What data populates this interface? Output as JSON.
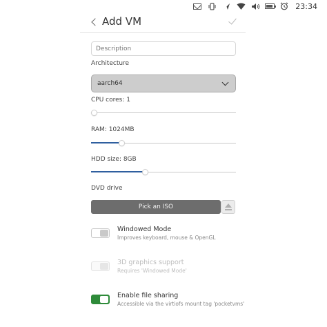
{
  "status_bar": {
    "time": "23:34",
    "icons": [
      "mail-icon",
      "vibrate-icon",
      "location-icon",
      "wifi-icon",
      "volume-icon",
      "battery-icon",
      "alarm-icon"
    ]
  },
  "header": {
    "title": "Add VM",
    "back_icon": "chevron-left-icon",
    "confirm_icon": "checkmark-icon"
  },
  "form": {
    "description_placeholder": "Description",
    "description_value": "",
    "architecture": {
      "label": "Architecture",
      "value": "aarch64"
    },
    "cpu": {
      "label": "CPU cores: 1",
      "value": 1,
      "fraction": 0.0
    },
    "ram": {
      "label": "RAM: 1024MB",
      "value_mb": 1024,
      "fraction": 0.21
    },
    "hdd": {
      "label": "HDD size: 8GB",
      "value_gb": 8,
      "fraction": 0.37
    },
    "dvd": {
      "label": "DVD drive",
      "pick_label": "Pick an ISO",
      "eject_icon": "eject-icon"
    },
    "options": [
      {
        "title": "Windowed Mode",
        "subtitle": "Improves keyboard, mouse & OpenGL",
        "checked": false,
        "enabled": true
      },
      {
        "title": "3D graphics support",
        "subtitle": "Requires 'Windowed Mode'",
        "checked": false,
        "enabled": false
      },
      {
        "title": "Enable file sharing",
        "subtitle": "Accessible via the virtiofs mount tag 'pocketvms'",
        "checked": true,
        "enabled": true
      }
    ]
  },
  "colors": {
    "accent_blue": "#2f5f9f",
    "toggle_on_green": "#2e8b3a",
    "button_gray": "#6d6d6d",
    "select_gray": "#cdcdcd"
  }
}
